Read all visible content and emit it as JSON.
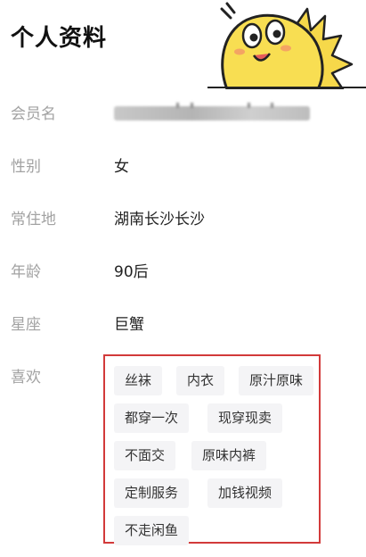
{
  "page": {
    "title": "个人资料"
  },
  "profile": {
    "member_name": {
      "label": "会员名"
    },
    "gender": {
      "label": "性别",
      "value": "女"
    },
    "residence": {
      "label": "常住地",
      "value": "湖南长沙长沙"
    },
    "age": {
      "label": "年龄",
      "value": "90后"
    },
    "zodiac": {
      "label": "星座",
      "value": "巨蟹"
    },
    "likes": {
      "label": "喜欢",
      "tags": [
        "丝袜",
        "内衣",
        "原汁原味",
        "都穿一次",
        "现穿现卖",
        "不面交",
        "原味内裤",
        "定制服务",
        "加钱视频",
        "不走闲鱼"
      ],
      "highlight_color": "#d23a3a"
    }
  },
  "mascot": {
    "icon": "yellow-fish-mascot-icon",
    "color": "#f6d84a"
  }
}
